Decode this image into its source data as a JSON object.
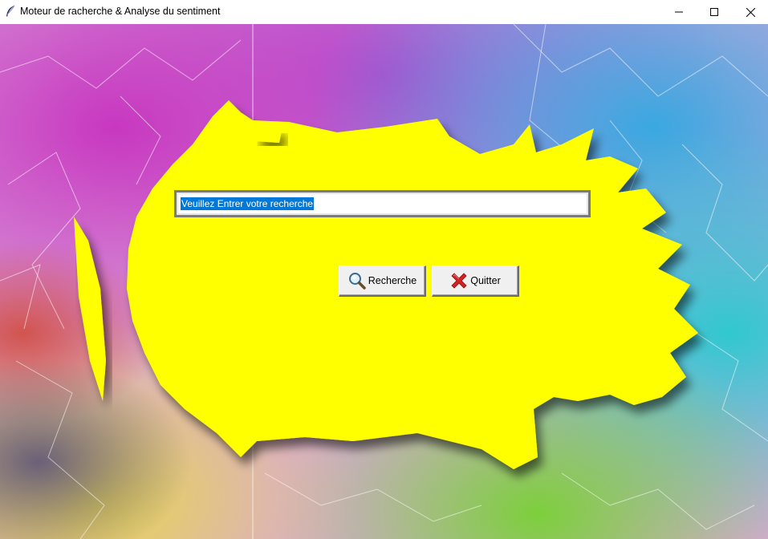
{
  "window": {
    "title": "Moteur de racherche & Analyse du sentiment",
    "app_icon": "feather-icon",
    "controls": [
      "minimize-icon",
      "maximize-icon",
      "close-icon"
    ]
  },
  "search": {
    "value": "Veuillez Entrer votre recherche",
    "selected": true
  },
  "buttons": {
    "search_label": "Recherche",
    "search_icon": "magnifier-icon",
    "quit_label": "Quitter",
    "quit_icon": "red-x-icon"
  },
  "colors": {
    "panel": "#ffff00",
    "selection": "#0078d7",
    "button_face": "#f0f0f0"
  }
}
